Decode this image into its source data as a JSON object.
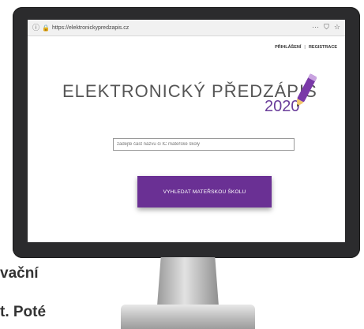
{
  "browser": {
    "url": "https://elektronickypredzapis.cz"
  },
  "top_links": {
    "login": "PŘIHLÁŠENÍ",
    "separator": "|",
    "register": "REGISTRACE"
  },
  "logo": {
    "title": "ELEKTRONICKÝ PŘEDZÁPIS",
    "year": "2020"
  },
  "search": {
    "placeholder": "zadejte část názvu či IČ mateřské školy"
  },
  "button": {
    "label": "VYHLEDAT MATEŘSKOU ŠKOLU"
  },
  "background_text": {
    "line1": "vační",
    "line2": "t. Poté"
  },
  "colors": {
    "accent": "#6a3094",
    "year": "#6a3d9a",
    "monitor": "#2b2b2d"
  }
}
